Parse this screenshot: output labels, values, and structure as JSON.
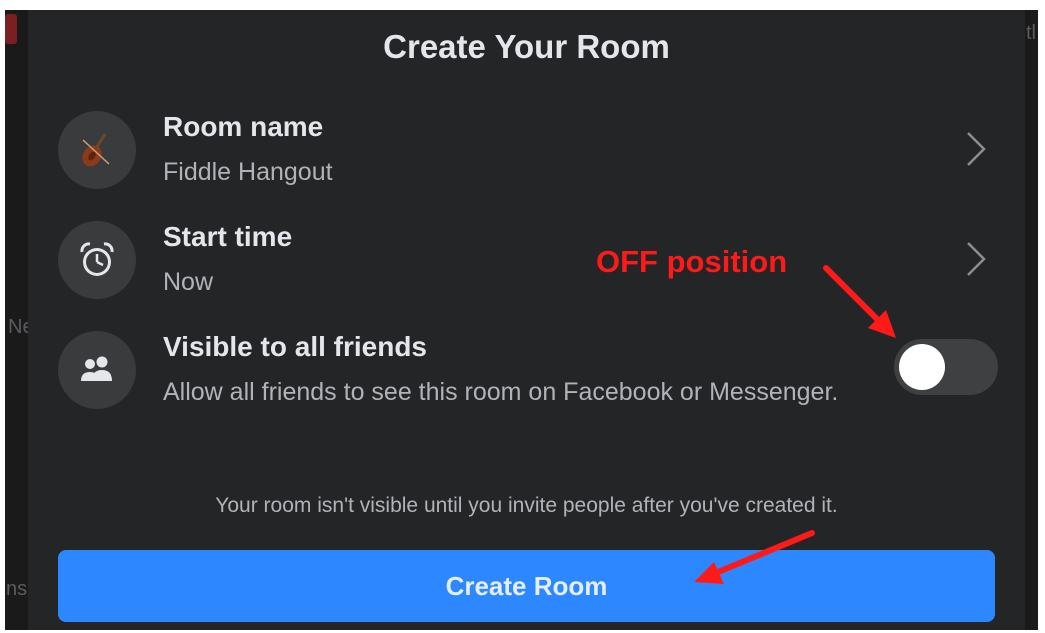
{
  "background": {
    "left_fragment_1": "Ne",
    "left_fragment_2": "ns",
    "right_fragment": "tl"
  },
  "dialog": {
    "title": "Create Your Room",
    "rows": [
      {
        "title": "Room name",
        "subtitle": "Fiddle Hangout",
        "icon": "fiddle-icon"
      },
      {
        "title": "Start time",
        "subtitle": "Now",
        "icon": "alarm-clock-icon"
      },
      {
        "title": "Visible to all friends",
        "subtitle": "Allow all friends to see this room on Facebook or Messenger.",
        "icon": "friends-icon",
        "toggle_on": false
      }
    ],
    "note": "Your room isn't visible until you invite people after you've created it.",
    "create_button": "Create Room"
  },
  "annotation": {
    "label": "OFF position",
    "color": "#ff1a1a"
  },
  "colors": {
    "dialog_bg": "#242526",
    "accent": "#2d88ff",
    "primary_text": "#e4e6eb",
    "secondary_text": "#b0b3b8"
  }
}
